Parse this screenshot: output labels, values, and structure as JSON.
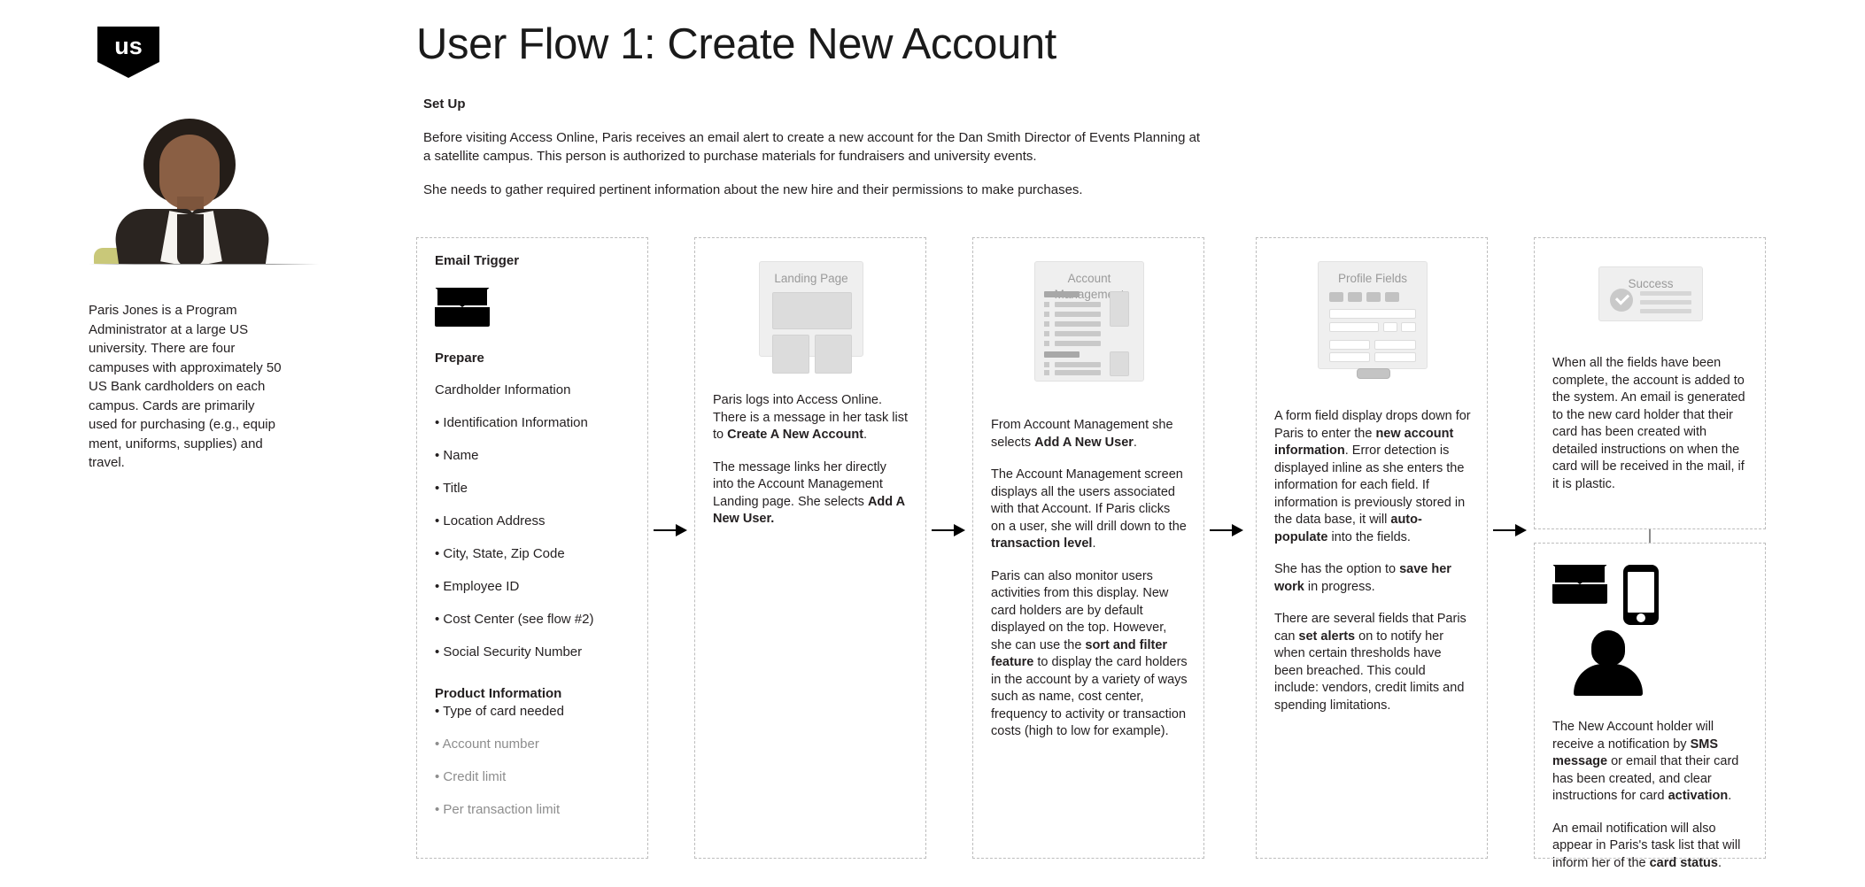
{
  "brand": {
    "logo_text": "us",
    "logo_name": "us-bank-shield-logo"
  },
  "header": {
    "title": "User Flow 1: Create New Account",
    "setup_heading": "Set Up",
    "setup_paragraphs": [
      "Before visiting Access Online, Paris receives an email alert to create a new account for the Dan Smith Director of Events Planning at a satellite campus. This person is authorized to purchase materials for fundraisers and university events.",
      "She needs to gather required pertinent information about the new hire and their permissions to make purchases."
    ]
  },
  "persona": {
    "photo_alt": "paris-jones-portrait",
    "description": "Paris Jones is a Program Administrator at a large US university. There are four campuses with approximately 50 US Bank cardholders on each campus. Cards are primarily used for purchasing (e.g., equip ment, uniforms, supplies) and travel."
  },
  "columns": {
    "c1": {
      "kicker": "Email Trigger",
      "icon": "envelope-icon",
      "prepare_heading": "Prepare",
      "cardholder_heading": "Cardholder Information",
      "cardholder_items": [
        "• Identification Information",
        "• Name",
        "• Title",
        "• Location Address",
        "• City, State, Zip Code",
        "• Employee ID",
        "• Cost Center (see flow #2)",
        "• Social Security Number"
      ],
      "product_heading": "Product Information",
      "product_first": "• Type of card needed",
      "product_items": [
        "• Account number",
        "• Credit limit",
        "• Per transaction limit"
      ]
    },
    "c2": {
      "mock_title": "Landing Page",
      "paragraphs": [
        {
          "parts": [
            {
              "t": "Paris logs into Access Online. There is a message in her task list to ",
              "b": false
            },
            {
              "t": "Create A New Account",
              "b": true
            },
            {
              "t": ".",
              "b": false
            }
          ]
        },
        {
          "parts": [
            {
              "t": "The message links her directly into the Account Management Landing page. She selects ",
              "b": false
            },
            {
              "t": "Add A New User.",
              "b": true
            }
          ]
        }
      ]
    },
    "c3": {
      "mock_title": "Account Management",
      "paragraphs": [
        {
          "parts": [
            {
              "t": "From Account Management she selects ",
              "b": false
            },
            {
              "t": "Add A New User",
              "b": true
            },
            {
              "t": ".",
              "b": false
            }
          ]
        },
        {
          "parts": [
            {
              "t": "The Account Management screen displays all the users associated with that Account. If Paris clicks on a user, she will drill down to the ",
              "b": false
            },
            {
              "t": "transaction level",
              "b": true
            },
            {
              "t": ".",
              "b": false
            }
          ]
        },
        {
          "parts": [
            {
              "t": "Paris can also monitor users activities from this display. New card holders are by default displayed on the top. However, she can use the ",
              "b": false
            },
            {
              "t": "sort and filter feature",
              "b": true
            },
            {
              "t": " to display the card holders in the account by a variety of ways such as name, cost center, frequency to activity or transaction costs (high to low for example).",
              "b": false
            }
          ]
        }
      ]
    },
    "c4": {
      "mock_title": "Profile Fields",
      "paragraphs": [
        {
          "parts": [
            {
              "t": "A form field display drops down for Paris to enter the ",
              "b": false
            },
            {
              "t": "new account information",
              "b": true
            },
            {
              "t": ". Error detection is displayed inline as she enters the information for each field. If information is previously stored in the data base, it will ",
              "b": false
            },
            {
              "t": "auto-populate",
              "b": true
            },
            {
              "t": " into the fields.",
              "b": false
            }
          ]
        },
        {
          "parts": [
            {
              "t": "She has the option to ",
              "b": false
            },
            {
              "t": "save her work",
              "b": true
            },
            {
              "t": " in progress.",
              "b": false
            }
          ]
        },
        {
          "parts": [
            {
              "t": "There are several fields that Paris can ",
              "b": false
            },
            {
              "t": "set alerts",
              "b": true
            },
            {
              "t": " on to notify her when certain thresholds have been breached. This could include: vendors, credit limits and spending limitations.",
              "b": false
            }
          ]
        }
      ]
    },
    "c5": {
      "mock_title": "Success",
      "paragraphs": [
        {
          "parts": [
            {
              "t": "When all the fields have been complete, the account is added to the system. An email is generated to the new card holder that their card has been created with detailed instructions on when the card will be received in the mail, if it is plastic.",
              "b": false
            }
          ]
        }
      ]
    },
    "c6": {
      "icons": [
        "envelope-icon",
        "mobile-phone-icon",
        "person-icon"
      ],
      "paragraphs": [
        {
          "parts": [
            {
              "t": "The New Account holder will receive a notification by ",
              "b": false
            },
            {
              "t": "SMS message",
              "b": true
            },
            {
              "t": " or email that their card has been created, and clear instructions for card ",
              "b": false
            },
            {
              "t": "activation",
              "b": true
            },
            {
              "t": ".",
              "b": false
            }
          ]
        },
        {
          "parts": [
            {
              "t": "An email notification will also appear in Paris's task list that will inform her of the ",
              "b": false
            },
            {
              "t": "card status",
              "b": true
            },
            {
              "t": ".",
              "b": false
            }
          ]
        }
      ]
    }
  },
  "colors": {
    "ink": "#231f20",
    "faint_text": "#8d8d8d",
    "dashed_border": "#bdbdbd",
    "wireframe_fill": "#efefef"
  }
}
